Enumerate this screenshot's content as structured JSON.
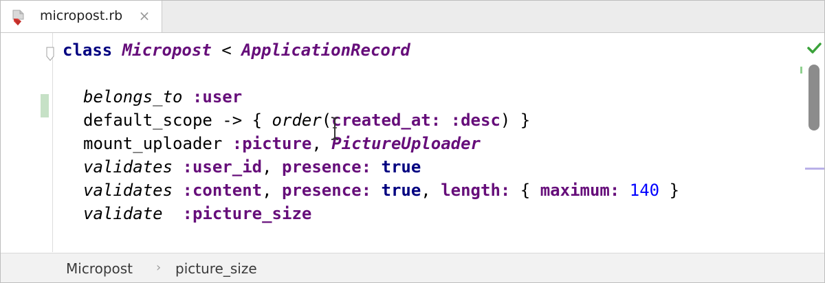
{
  "tab": {
    "filename": "micropost.rb",
    "close_symbol": "×",
    "icon": "ruby-file-icon",
    "icon_color": "#e0433d"
  },
  "code": {
    "l1": {
      "kw": "class",
      "cls": "Micropost",
      "op": " < ",
      "base": "ApplicationRecord"
    },
    "l3": {
      "method": "belongs_to",
      "sym": " :user"
    },
    "l4": {
      "a": "default_scope -> { ",
      "method": "order",
      "b": "(",
      "key": "created_at:",
      "c": " ",
      "sym": ":desc",
      "d": ") }"
    },
    "l5": {
      "a": "mount_uploader ",
      "sym": ":picture",
      "b": ", ",
      "cls": "PictureUploader"
    },
    "l6": {
      "method": "validates",
      "sym": " :user_id",
      "a": ", ",
      "key": "presence:",
      "b": " ",
      "val": "true"
    },
    "l7": {
      "method": "validates",
      "sym": " :content",
      "a": ", ",
      "key": "presence:",
      "b": " ",
      "val": "true",
      "c": ", ",
      "key2": "length:",
      "d": " { ",
      "key3": "maximum:",
      "e": " ",
      "num": "140",
      "f": " }"
    },
    "l8": {
      "method": "validate",
      "gap": "  ",
      "sym": ":picture_size"
    }
  },
  "breadcrumb": {
    "items": [
      "Micropost",
      "picture_size"
    ],
    "separator": "›"
  },
  "status": {
    "inspection": "check-icon",
    "color": "#3aa23a"
  }
}
